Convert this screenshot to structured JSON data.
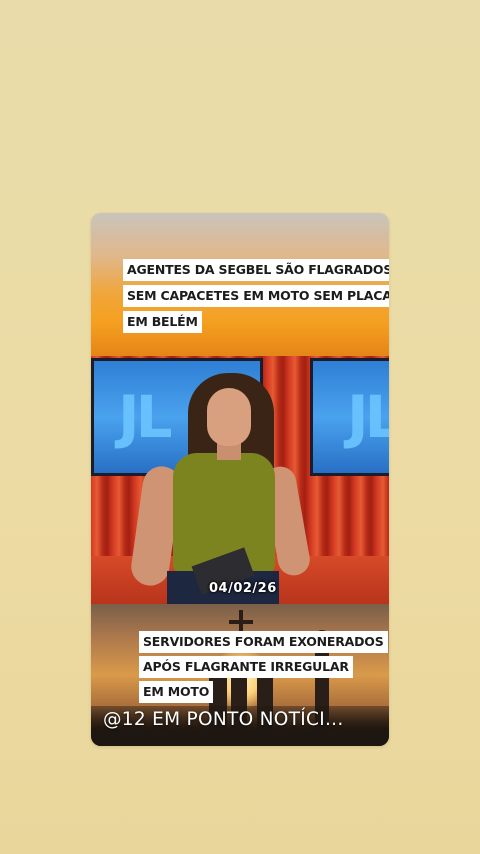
{
  "story": {
    "headline_top": [
      "AGENTES DA SEGBEL SÃO FLAGRADOS",
      "SEM CAPACETES EM MOTO SEM PLACA,",
      "EM BELÉM"
    ],
    "date_overlay": "04/02/26",
    "screen_logo": "JL",
    "headline_bottom": [
      "SERVIDORES FORAM EXONERADOS",
      "APÓS FLAGRANTE IRREGULAR",
      "EM MOTO"
    ],
    "handle": "@12 EM PONTO NOTÍCI..."
  },
  "colors": {
    "page_background": "#ecdba3",
    "headline_bg": "#ffffff",
    "anchor_top": "#7c8420",
    "screen_blue": "#3a8fe0",
    "curtain_red": "#c52f1d"
  }
}
